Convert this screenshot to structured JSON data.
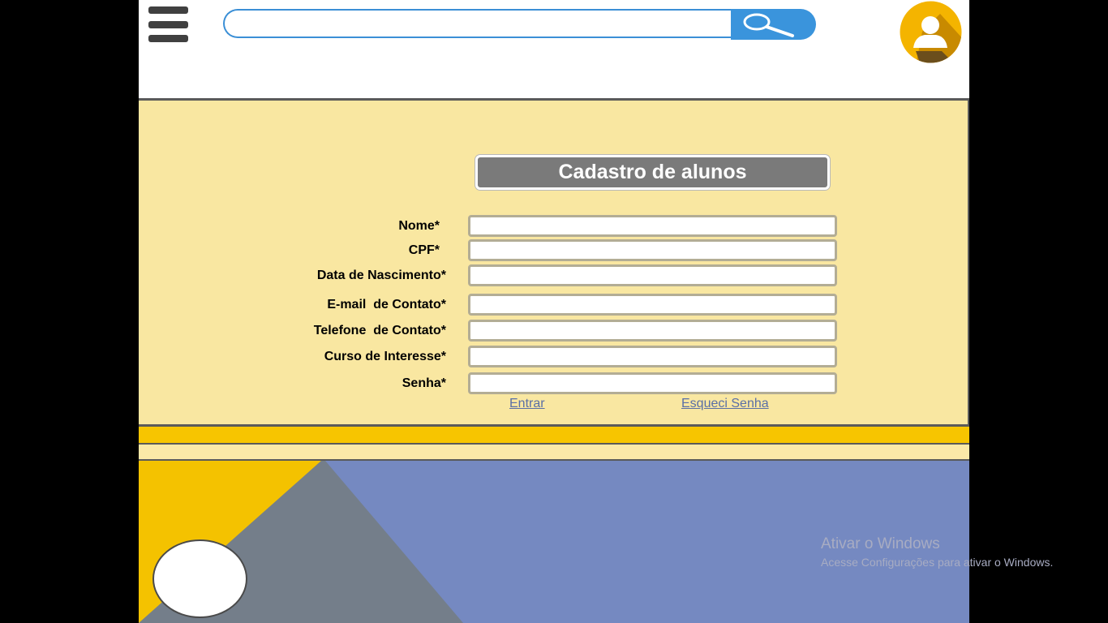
{
  "header": {
    "search": {
      "value": "",
      "placeholder": ""
    }
  },
  "form": {
    "title": "Cadastro de alunos",
    "fields": [
      {
        "label": "Nome*",
        "value": ""
      },
      {
        "label": "CPF*",
        "value": ""
      },
      {
        "label": "Data de Nascimento*",
        "value": ""
      },
      {
        "label": "E-mail  de Contato*",
        "value": ""
      },
      {
        "label": "Telefone  de Contato*",
        "value": ""
      },
      {
        "label": "Curso de Interesse*",
        "value": ""
      },
      {
        "label": "Senha*",
        "value": ""
      }
    ],
    "links": {
      "enter": "Entrar",
      "forgot": "Esqueci Senha"
    }
  },
  "watermark": {
    "title": "Ativar o Windows",
    "subtitle": "Acesse Configurações para ativar o Windows."
  },
  "icons": {
    "menu": "hamburger-menu-icon",
    "search": "magnifier-icon",
    "avatar": "user-profile-icon"
  },
  "colors": {
    "panel": "#f9e7a1",
    "accent_yellow": "#f7c500",
    "search_blue": "#3a94dc",
    "title_gray": "#7a7a7a",
    "footer_blue": "#7589c1",
    "footer_gray": "#747e8a",
    "avatar_orange": "#f4b400"
  }
}
